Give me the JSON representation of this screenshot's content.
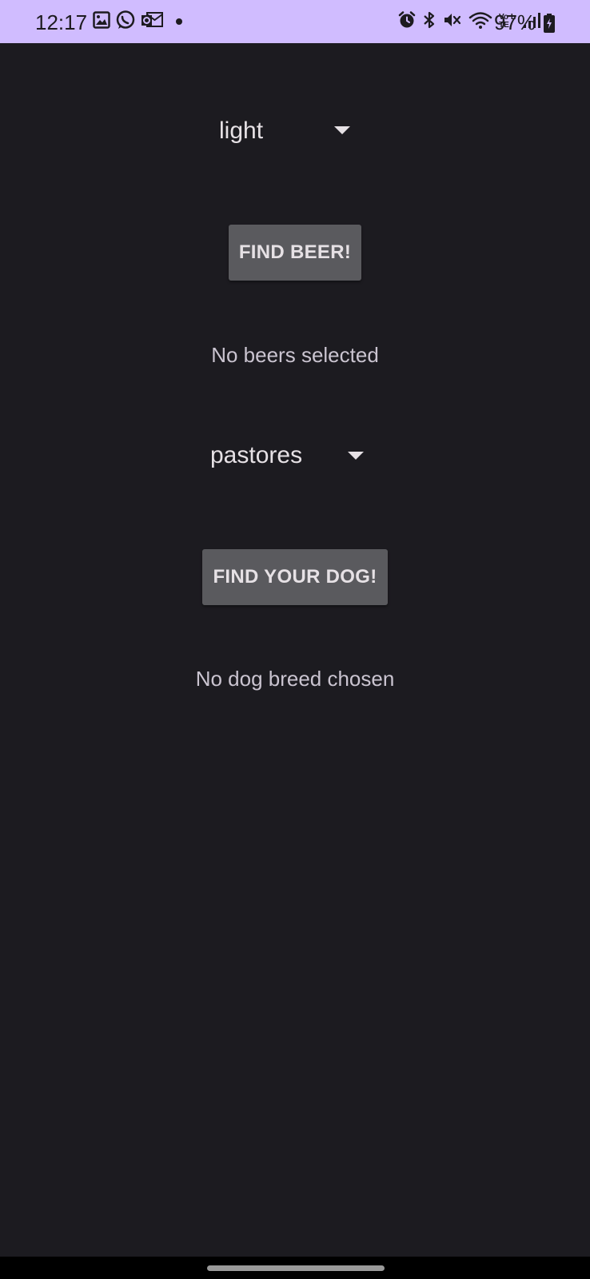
{
  "status_bar": {
    "time": "12:17",
    "battery": "97%",
    "left_icons": [
      "gallery-icon",
      "whatsapp-icon",
      "outlook-icon",
      "notification-dot"
    ],
    "right_icons": [
      "alarm-icon",
      "bluetooth-icon",
      "mute-icon",
      "wifi-icon",
      "volte-icon",
      "signal-icon"
    ],
    "volte_label": "Vo LTE"
  },
  "beer": {
    "spinner_value": "light",
    "button_label": "FIND BEER!",
    "result_text": "No beers selected"
  },
  "dog": {
    "spinner_value": "pastores",
    "button_label": "FIND YOUR DOG!",
    "result_text": "No dog breed chosen"
  },
  "colors": {
    "status_bar_bg": "#d0bcff",
    "background": "#1c1b20",
    "button_bg": "#5a5a5e",
    "text": "#e6e1e5"
  }
}
